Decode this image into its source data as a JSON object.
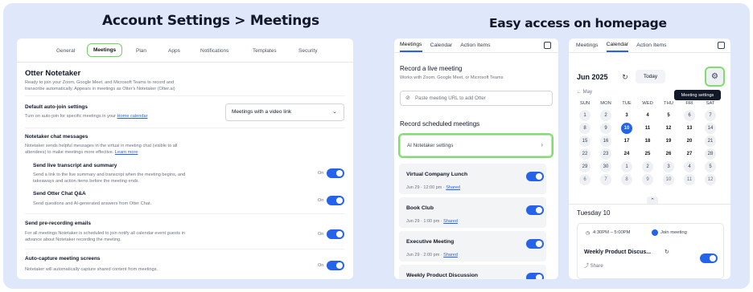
{
  "headings": {
    "left": "Account Settings > Meetings",
    "right": "Easy access on homepage"
  },
  "left": {
    "tabs": [
      "General",
      "Meetings",
      "Plan",
      "Apps",
      "Notifications",
      "Templates",
      "Security"
    ],
    "active_tab": "Meetings",
    "title": "Otter Notetaker",
    "intro_line1": "Ready to join your Zoom, Google Meet, and Microsoft Teams to record and",
    "intro_line2": "transcribe automatically. Appears in meetings as Otter's Notetaker (Otter.ai)",
    "autojoin_title": "Default auto-join settings",
    "autojoin_desc_pre": "Turn on auto-join for specific meetings in your ",
    "autojoin_link": "Home calendar",
    "autojoin_select": "Meetings with a video link",
    "chat_title": "Notetaker chat messages",
    "chat_desc1": "Notetaker sends helpful messages in the virtual in meeting chat (visible to all",
    "chat_desc2_pre": "attendees) to make meetings more effective. ",
    "chat_link": "Learn more",
    "opt1_title": "Send live transcript and summary",
    "opt1_desc1": "Send a link to the live summary and transcript when the meeting begins, and",
    "opt1_desc2": "takeaways and action items before the meeting ends.",
    "opt2_title": "Send Otter Chat Q&A",
    "opt2_desc": "Send questions and AI-generated answers from Otter Chat.",
    "prerec_title": "Send pre-recording emails",
    "prerec_desc1": "For all meetings Notetaker is scheduled to join notify all calendar event guests in",
    "prerec_desc2": "advance about Notetaker recording the meeting.",
    "capture_title": "Auto-capture meeting screens",
    "capture_desc": "Notetaker will automatically capture shared content from meetings.",
    "on_label": "On"
  },
  "middle": {
    "tabs": [
      "Meetings",
      "Calendar",
      "Action Items"
    ],
    "record_live_title": "Record a live meeting",
    "record_live_desc": "Works with Zoom, Google Meet, or Microsoft Teams",
    "url_placeholder": "Paste meeting URL to add Otter",
    "scheduled_title": "Record scheduled meetings",
    "notetaker_settings": "AI Notetaker settings",
    "meetings": [
      {
        "title": "Virtual Company Lunch",
        "time": "Jun 29 · 12:00 pm · ",
        "shared": "Shared"
      },
      {
        "title": "Book Club",
        "time": "Jun 29 · 1:00 pm · ",
        "shared": "Shared"
      },
      {
        "title": "Executive Meeting",
        "time": "Jun 29 · 2:00 pm · ",
        "shared": "Shared"
      },
      {
        "title": "Weekly Product Discussion",
        "time": "",
        "shared": ""
      }
    ]
  },
  "right": {
    "tabs": [
      "Meetings",
      "Calendar",
      "Action Items"
    ],
    "month": "Jun 2025",
    "today_btn": "Today",
    "tooltip": "Meeting settings",
    "prev_month": "May",
    "dow": [
      "SUN",
      "MON",
      "TUE",
      "WED",
      "THU",
      "FRI",
      "SAT"
    ],
    "weeks": [
      [
        "1",
        "2",
        "3",
        "4",
        "5",
        "6",
        "7"
      ],
      [
        "8",
        "9",
        "10",
        "11",
        "12",
        "13",
        "14"
      ],
      [
        "15",
        "16",
        "17",
        "18",
        "19",
        "20",
        "21"
      ],
      [
        "22",
        "23",
        "24",
        "25",
        "26",
        "27",
        "28"
      ],
      [
        "29",
        "30",
        "1",
        "2",
        "3",
        "4",
        "5"
      ],
      [
        "6",
        "7",
        "8",
        "9",
        "10",
        "11",
        "12"
      ]
    ],
    "selected_day": "10",
    "day_label": "Tuesday 10",
    "event_time": "4:30PM – 5:00PM",
    "join_label": "Join meeting",
    "event_title": "Weekly Product Discus...",
    "share_label": "Share"
  }
}
